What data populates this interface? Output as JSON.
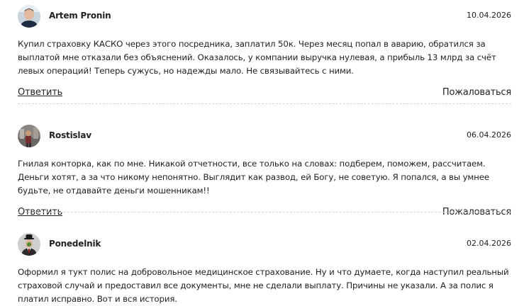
{
  "reviews": [
    {
      "author": "Artem Pronin",
      "date": "10.04.2026",
      "text": "Купил страховку КАСКО через этого посредника, заплатил 50к. Через месяц попал в аварию, обратился за выплатой мне отказали без объяснений. Оказалось, у компании выручка нулевая, а прибыль 13 млрд за счёт левых операций! Теперь сужусь, но надежды мало. Не связывайтесь с ними.",
      "reply_label": "Ответить",
      "report_label": "Пожаловаться"
    },
    {
      "author": "Rostislav",
      "date": "06.04.2026",
      "text": "Гнилая конторка, как по мне. Никакой отчетности, все только на словах: подберем, поможем, рассчитаем. Деньги хотят, а за что никому непонятно. Выглядит как развод, ей Богу, не советую. Я попался, а вы умнее будьте, не отдавайте деньги мошенникам!!",
      "reply_label": "Ответить",
      "report_label": "Пожаловаться"
    },
    {
      "author": "Ponedelnik",
      "date": "02.04.2026",
      "text": "Оформил я тукт полис на добровольное медицинское страхование. Ну и что думаете, когда наступил реальный страховой случай и предоставил все документы, мне не сделали выплату. Причины не указали. А за полис я платил исправно. Вот и вся история.",
      "reply_label": "Ответить",
      "report_label": "Пожаловаться"
    }
  ]
}
